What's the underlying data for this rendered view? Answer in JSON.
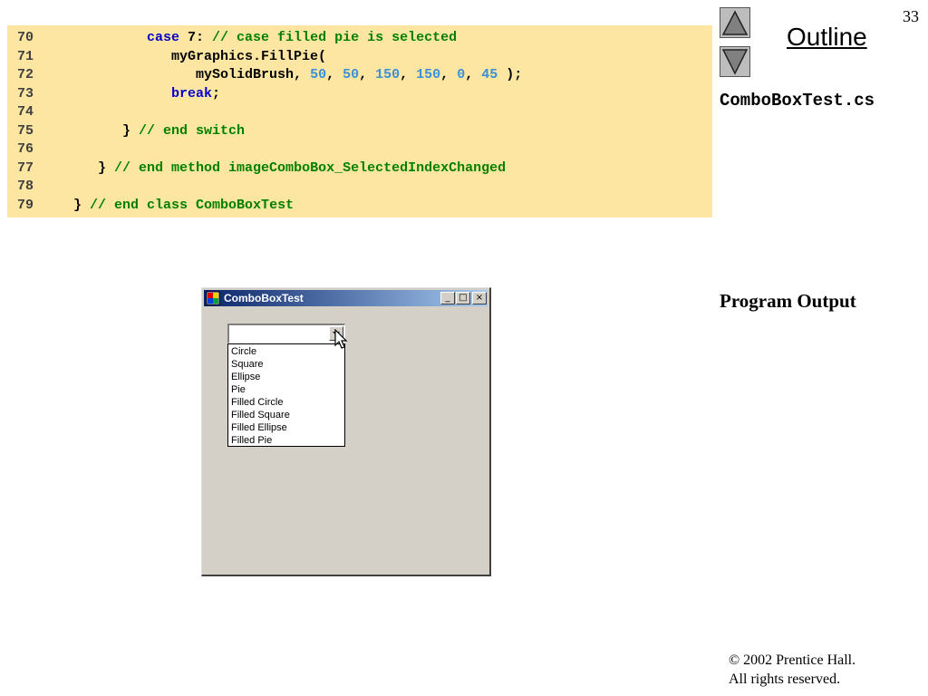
{
  "page_number": "33",
  "outline": {
    "label": "Outline"
  },
  "filename": "ComboBoxTest.cs",
  "code_lines": [
    {
      "num": "70",
      "indent": "          ",
      "tokens": [
        {
          "t": "case",
          "c": "k"
        },
        {
          "t": " 7: ",
          "c": "p"
        },
        {
          "t": "// case filled pie is selected",
          "c": "c"
        }
      ]
    },
    {
      "num": "71",
      "indent": "             ",
      "tokens": [
        {
          "t": "myGraphics.FillPie(",
          "c": "p"
        }
      ]
    },
    {
      "num": "72",
      "indent": "                ",
      "tokens": [
        {
          "t": "mySolidBrush, ",
          "c": "p"
        },
        {
          "t": "50",
          "c": "n"
        },
        {
          "t": ", ",
          "c": "p"
        },
        {
          "t": "50",
          "c": "n"
        },
        {
          "t": ", ",
          "c": "p"
        },
        {
          "t": "150",
          "c": "n"
        },
        {
          "t": ", ",
          "c": "p"
        },
        {
          "t": "150",
          "c": "n"
        },
        {
          "t": ", ",
          "c": "p"
        },
        {
          "t": "0",
          "c": "n"
        },
        {
          "t": ", ",
          "c": "p"
        },
        {
          "t": "45",
          "c": "n"
        },
        {
          "t": " );",
          "c": "p"
        }
      ]
    },
    {
      "num": "73",
      "indent": "             ",
      "tokens": [
        {
          "t": "break",
          "c": "k"
        },
        {
          "t": ";",
          "c": "p"
        }
      ]
    },
    {
      "num": "74",
      "indent": "",
      "tokens": []
    },
    {
      "num": "75",
      "indent": "       ",
      "tokens": [
        {
          "t": "} ",
          "c": "p"
        },
        {
          "t": "// end switch",
          "c": "c"
        }
      ]
    },
    {
      "num": "76",
      "indent": "",
      "tokens": []
    },
    {
      "num": "77",
      "indent": "    ",
      "tokens": [
        {
          "t": "} ",
          "c": "p"
        },
        {
          "t": "// end method imageComboBox_SelectedIndexChanged",
          "c": "c"
        }
      ]
    },
    {
      "num": "78",
      "indent": "",
      "tokens": []
    },
    {
      "num": "79",
      "indent": " ",
      "tokens": [
        {
          "t": "} ",
          "c": "p"
        },
        {
          "t": "// end class ComboBoxTest",
          "c": "c"
        }
      ]
    }
  ],
  "output_label": "Program Output",
  "window": {
    "title": "ComboBoxTest",
    "caption_buttons": [
      "_",
      "□",
      "×"
    ],
    "combo_value": "",
    "options": [
      "Circle",
      "Square",
      "Ellipse",
      "Pie",
      "Filled Circle",
      "Filled Square",
      "Filled Ellipse",
      "Filled Pie"
    ]
  },
  "copyright": {
    "line1": "© 2002 Prentice Hall.",
    "line2": "All rights reserved."
  },
  "icons": {
    "nav_up": "triangle-up-icon",
    "nav_down": "triangle-down-icon",
    "app": "app-window-icon",
    "dropdown": "chevron-down-icon",
    "cursor": "mouse-pointer-icon"
  },
  "colors": {
    "code_background": "#fde6a2",
    "keyword": "#0000cc",
    "comment": "#008000",
    "number": "#3b8fd6",
    "titlebar_start": "#0a246a",
    "titlebar_end": "#a6caf0",
    "window_face": "#d4d0c8"
  }
}
